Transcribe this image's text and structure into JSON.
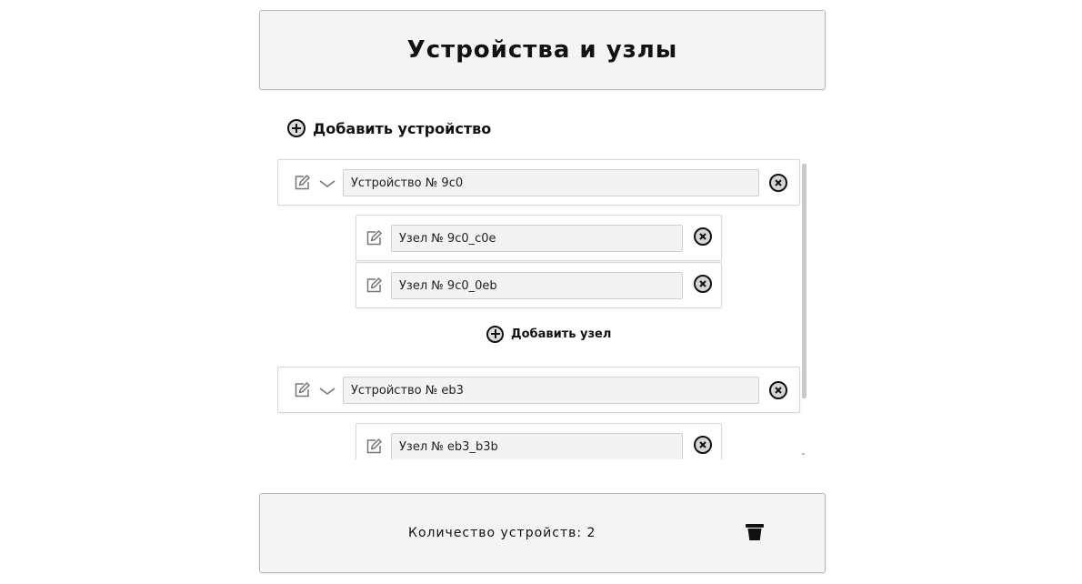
{
  "header": {
    "title": "Устройства и узлы"
  },
  "actions": {
    "add_device_label": "Добавить устройство",
    "add_node_label": "Добавить узел"
  },
  "devices": [
    {
      "name": "Устройство № 9c0",
      "expanded": true,
      "nodes": [
        {
          "name": "Узел № 9c0_c0e"
        },
        {
          "name": "Узел № 9c0_0eb"
        }
      ]
    },
    {
      "name": "Устройство № eb3",
      "expanded": true,
      "nodes": [
        {
          "name": "Узел № eb3_b3b"
        }
      ]
    }
  ],
  "footer": {
    "device_count_text": "Количество устройств: 2"
  },
  "icons": {
    "add": "plus-circle-icon",
    "edit": "pencil-square-icon",
    "expand": "chevron-down-icon",
    "remove": "close-circle-icon",
    "clear": "trash-icon"
  },
  "colors": {
    "panel_bg": "#f4f4f4",
    "input_bg": "#f3f3f3",
    "border": "#b8b8b8",
    "text": "#111111"
  }
}
